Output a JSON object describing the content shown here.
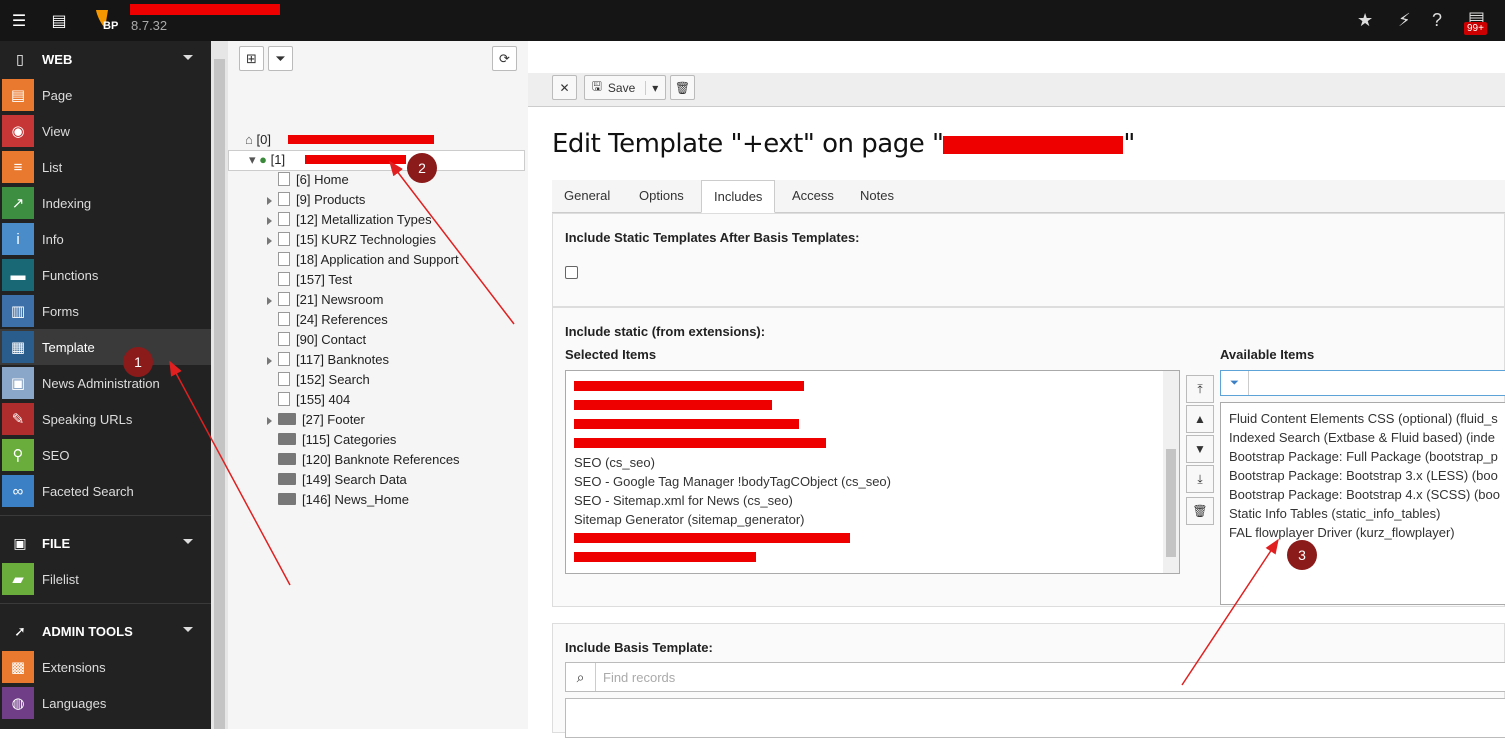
{
  "topbar": {
    "logo_text": "BP",
    "version": "8.7.32",
    "notifications_badge": "99+"
  },
  "modules": {
    "web_group": "WEB",
    "web_items": [
      {
        "label": "Page",
        "icon": "page-icon",
        "color": "#e9792f"
      },
      {
        "label": "View",
        "icon": "eye-icon",
        "color": "#c73636"
      },
      {
        "label": "List",
        "icon": "list-icon",
        "color": "#e9792f"
      },
      {
        "label": "Indexing",
        "icon": "chart-icon",
        "color": "#3e8e41"
      },
      {
        "label": "Info",
        "icon": "info-icon",
        "color": "#4a8bc9"
      },
      {
        "label": "Functions",
        "icon": "briefcase-icon",
        "color": "#186875"
      },
      {
        "label": "Forms",
        "icon": "form-icon",
        "color": "#3d6fa8"
      },
      {
        "label": "Template",
        "icon": "template-icon",
        "color": "#2b5d8c"
      },
      {
        "label": "News Administration",
        "icon": "news-icon",
        "color": "#8aa6c8"
      },
      {
        "label": "Speaking URLs",
        "icon": "pen-icon",
        "color": "#b02d2d"
      },
      {
        "label": "SEO",
        "icon": "search-icon",
        "color": "#6aad3d"
      },
      {
        "label": "Faceted Search",
        "icon": "binoculars-icon",
        "color": "#3b7fc4"
      }
    ],
    "file_group": "FILE",
    "file_items": [
      {
        "label": "Filelist",
        "icon": "folder-icon",
        "color": "#6aad3d"
      }
    ],
    "admin_group": "ADMIN TOOLS",
    "admin_items": [
      {
        "label": "Extensions",
        "icon": "box-icon",
        "color": "#e9792f"
      },
      {
        "label": "Languages",
        "icon": "globe-icon",
        "color": "#6f3e87"
      }
    ]
  },
  "tree": {
    "root_id": "[0]",
    "site_id": "[1]",
    "nodes": [
      {
        "label": "[6] Home",
        "type": "page",
        "expandable": false
      },
      {
        "label": "[9] Products",
        "type": "page",
        "expandable": true
      },
      {
        "label": "[12] Metallization Types",
        "type": "page",
        "expandable": true
      },
      {
        "label": "[15] KURZ Technologies",
        "type": "page",
        "expandable": true
      },
      {
        "label": "[18] Application and Support",
        "type": "page",
        "expandable": false
      },
      {
        "label": "[157] Test",
        "type": "page",
        "expandable": false
      },
      {
        "label": "[21] Newsroom",
        "type": "page",
        "expandable": true
      },
      {
        "label": "[24] References",
        "type": "page",
        "expandable": false
      },
      {
        "label": "[90] Contact",
        "type": "page",
        "expandable": false
      },
      {
        "label": "[117] Banknotes",
        "type": "page",
        "expandable": true
      },
      {
        "label": "[152] Search",
        "type": "page",
        "expandable": false
      },
      {
        "label": "[155] 404",
        "type": "page",
        "expandable": false
      },
      {
        "label": "[27] Footer",
        "type": "folder",
        "expandable": true
      },
      {
        "label": "[115] Categories",
        "type": "folder",
        "expandable": false
      },
      {
        "label": "[120] Banknote References",
        "type": "folder",
        "expandable": false
      },
      {
        "label": "[149] Search Data",
        "type": "folder",
        "expandable": false
      },
      {
        "label": "[146] News_Home",
        "type": "folder",
        "expandable": false
      }
    ]
  },
  "toolbar": {
    "save_label": "Save"
  },
  "main": {
    "title_prefix": "Edit Template \"+ext\" on page \"",
    "title_suffix": "\"",
    "tabs": [
      "General",
      "Options",
      "Includes",
      "Access",
      "Notes"
    ],
    "active_tab": "Includes",
    "after_basis_label": "Include Static Templates After Basis Templates:",
    "include_static_label": "Include static (from extensions):",
    "selected_label": "Selected Items",
    "available_label": "Available Items",
    "selected_items": [
      "SEO (cs_seo)",
      "SEO - Google Tag Manager !bodyTagCObject (cs_seo)",
      "SEO - Sitemap.xml for News (cs_seo)",
      "Sitemap Generator (sitemap_generator)"
    ],
    "available_items": [
      "Fluid Content Elements CSS (optional) (fluid_s",
      "Indexed Search (Extbase & Fluid based) (inde",
      "Bootstrap Package: Full Package (bootstrap_p",
      "Bootstrap Package: Bootstrap 3.x (LESS) (boo",
      "Bootstrap Package: Bootstrap 4.x (SCSS) (boo",
      "Static Info Tables (static_info_tables)",
      "FAL flowplayer Driver (kurz_flowplayer)"
    ],
    "basis_label": "Include Basis Template:",
    "find_placeholder": "Find records"
  },
  "annotations": [
    "1",
    "2",
    "3"
  ],
  "colors": {
    "annotation": "#8b1a1a",
    "arrow": "#e02020",
    "redaction": "#ee0000"
  }
}
